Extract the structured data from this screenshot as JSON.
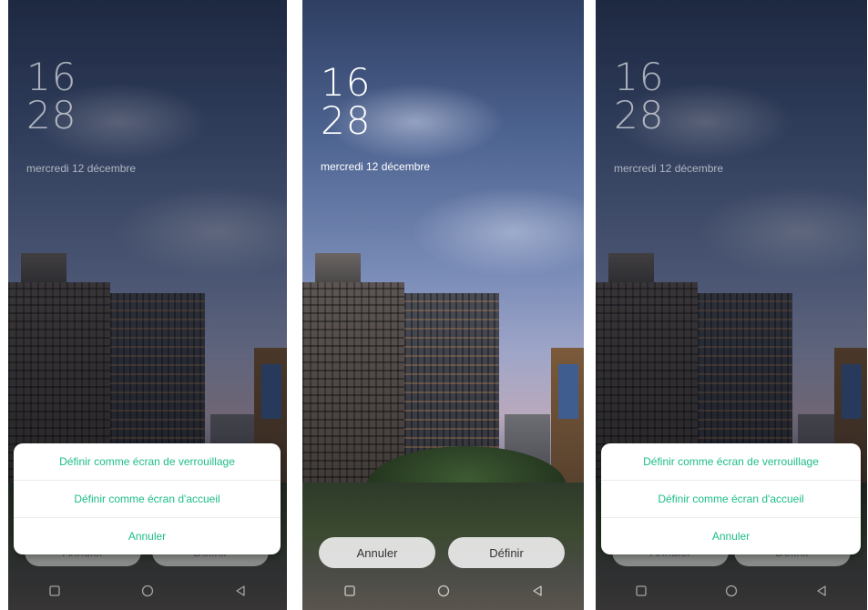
{
  "lockscreen": {
    "hour": "16",
    "minute": "28",
    "date": "mercredi 12 décembre"
  },
  "wallpaper_sheet": {
    "options": [
      "Définir comme écran de verrouillage",
      "Définir comme écran d'accueil",
      "Annuler"
    ]
  },
  "preview_actions": {
    "cancel_label": "Annuler",
    "apply_label": "Définir"
  },
  "navbar": {
    "icons": [
      "square-recents-icon",
      "circle-home-icon",
      "triangle-back-icon"
    ]
  },
  "colors": {
    "sheet_text": "#1dbe85",
    "sheet_background": "#ffffff"
  }
}
